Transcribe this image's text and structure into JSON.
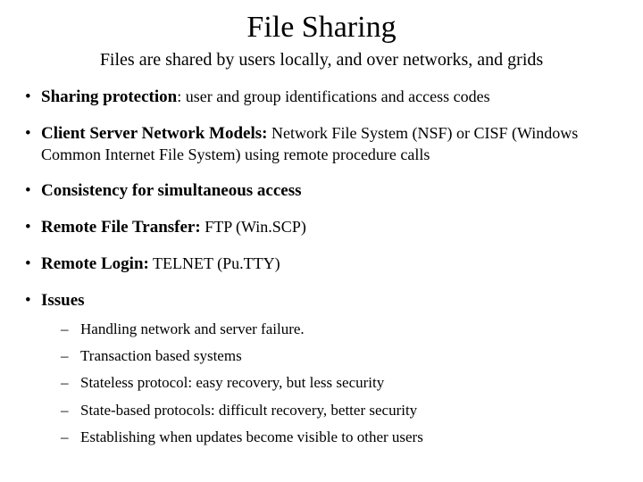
{
  "title": "File Sharing",
  "subtitle": "Files are shared by users locally, and over networks, and grids",
  "bullets": [
    {
      "lead": "Sharing protection",
      "sep": ": ",
      "rest": "user and group identifications and access codes"
    },
    {
      "lead": "Client Server Network Models:",
      "sep": " ",
      "rest": "Network File System (NSF) or CISF (Windows Common Internet File System) using remote procedure calls"
    },
    {
      "lead": "Consistency for simultaneous access",
      "sep": "",
      "rest": ""
    },
    {
      "lead": "Remote File Transfer:",
      "sep": " ",
      "rest": "FTP (Win.SCP)"
    },
    {
      "lead": "Remote Login:",
      "sep": " ",
      "rest": "TELNET (Pu.TTY)"
    },
    {
      "lead": "Issues",
      "sep": "",
      "rest": ""
    }
  ],
  "sub": [
    "Handling network and server failure.",
    "Transaction based systems",
    "Stateless protocol: easy recovery, but less security",
    "State-based protocols: difficult recovery, better security",
    "Establishing when updates become visible to other users"
  ]
}
